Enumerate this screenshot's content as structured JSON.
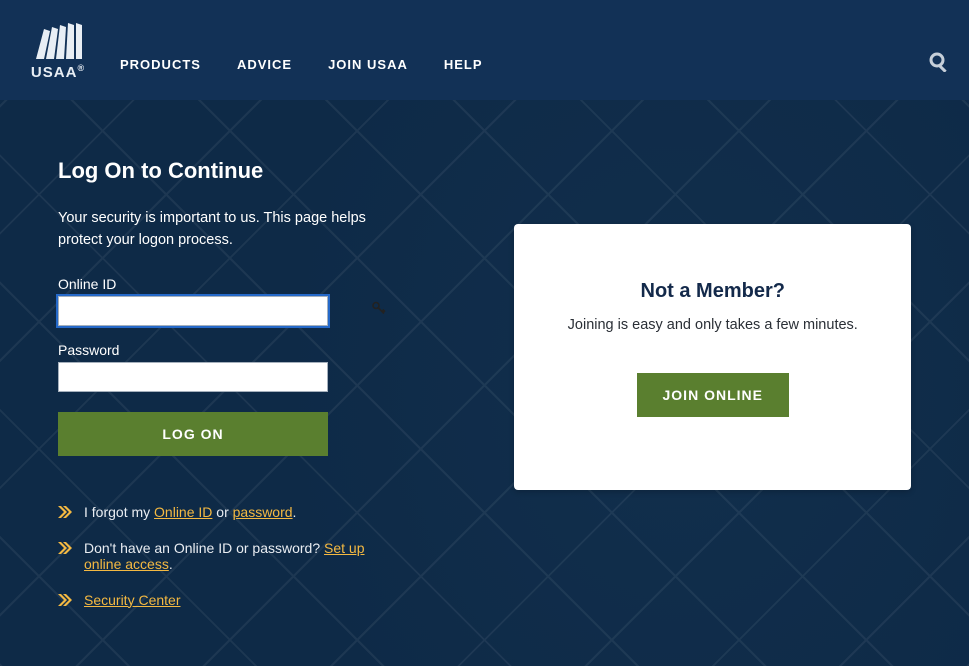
{
  "brand": {
    "name": "USAA",
    "registered": "®"
  },
  "nav": {
    "products": "PRODUCTS",
    "advice": "ADVICE",
    "join": "JOIN USAA",
    "help": "HELP"
  },
  "page": {
    "title": "Log On to Continue",
    "subtitle": "Your security is important to us. This page helps protect your logon process."
  },
  "form": {
    "onlineIdLabel": "Online ID",
    "onlineIdValue": "",
    "passwordLabel": "Password",
    "passwordValue": "",
    "logonButton": "LOG ON"
  },
  "help": {
    "forgot_prefix": "I forgot my ",
    "forgot_onlineId": "Online ID",
    "forgot_or": " or ",
    "forgot_password": "password",
    "forgot_period": ".",
    "setup_prefix": "Don't have an Online ID or password? ",
    "setup_link": "Set up online access",
    "setup_period": ".",
    "security_center": "Security Center"
  },
  "card": {
    "title": "Not a Member?",
    "text": "Joining is easy and only takes a few minutes.",
    "button": "JOIN ONLINE"
  }
}
